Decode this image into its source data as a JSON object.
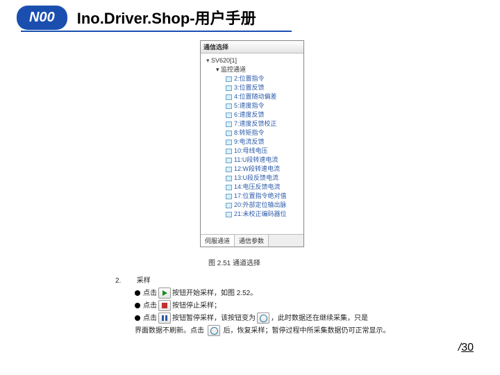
{
  "header": {
    "logo": "N00",
    "title": "Ino.Driver.Shop-用户手册"
  },
  "panel": {
    "title": "通信选择",
    "root": "SV620[1]",
    "group": "监控通道",
    "items": [
      "2:位置指令",
      "3:位置反馈",
      "4:位置随动偏差",
      "5:速度指令",
      "6:速度反馈",
      "7:速度反馈校正",
      "8:转矩指令",
      "9:电流反馈",
      "10:母线电压",
      "11:U段转速电流",
      "12:W段转速电流",
      "13:U段反馈电流",
      "14:电压反馈电流",
      "17:位置指令绝对值",
      "20:外部定位输出脉",
      "21:未校正编码器位"
    ],
    "tabs": [
      "伺服通道",
      "通信参数"
    ]
  },
  "figure": {
    "caption": "图 2.51 通道选择"
  },
  "steps": {
    "num": "2.",
    "label": "采样",
    "lines": [
      {
        "pre": "点击",
        "icon": "play",
        "post": "按钮开始采样，如图 2.52。"
      },
      {
        "pre": "点击",
        "icon": "stop",
        "post": "按钮停止采样；"
      },
      {
        "pre": "点击",
        "icon": "pause",
        "post": "按钮暂停采样，该按钮变为",
        "icon2": "circle",
        "post2": "，此时数据还在继续采集，只是"
      }
    ],
    "tail": {
      "pre": "界面数据不刷新。点击",
      "icon": "circle",
      "post": "后，恢复采样；暂停过程中所采集数据仍可正常显示。"
    }
  },
  "page": {
    "sep": "/",
    "total": "30"
  }
}
